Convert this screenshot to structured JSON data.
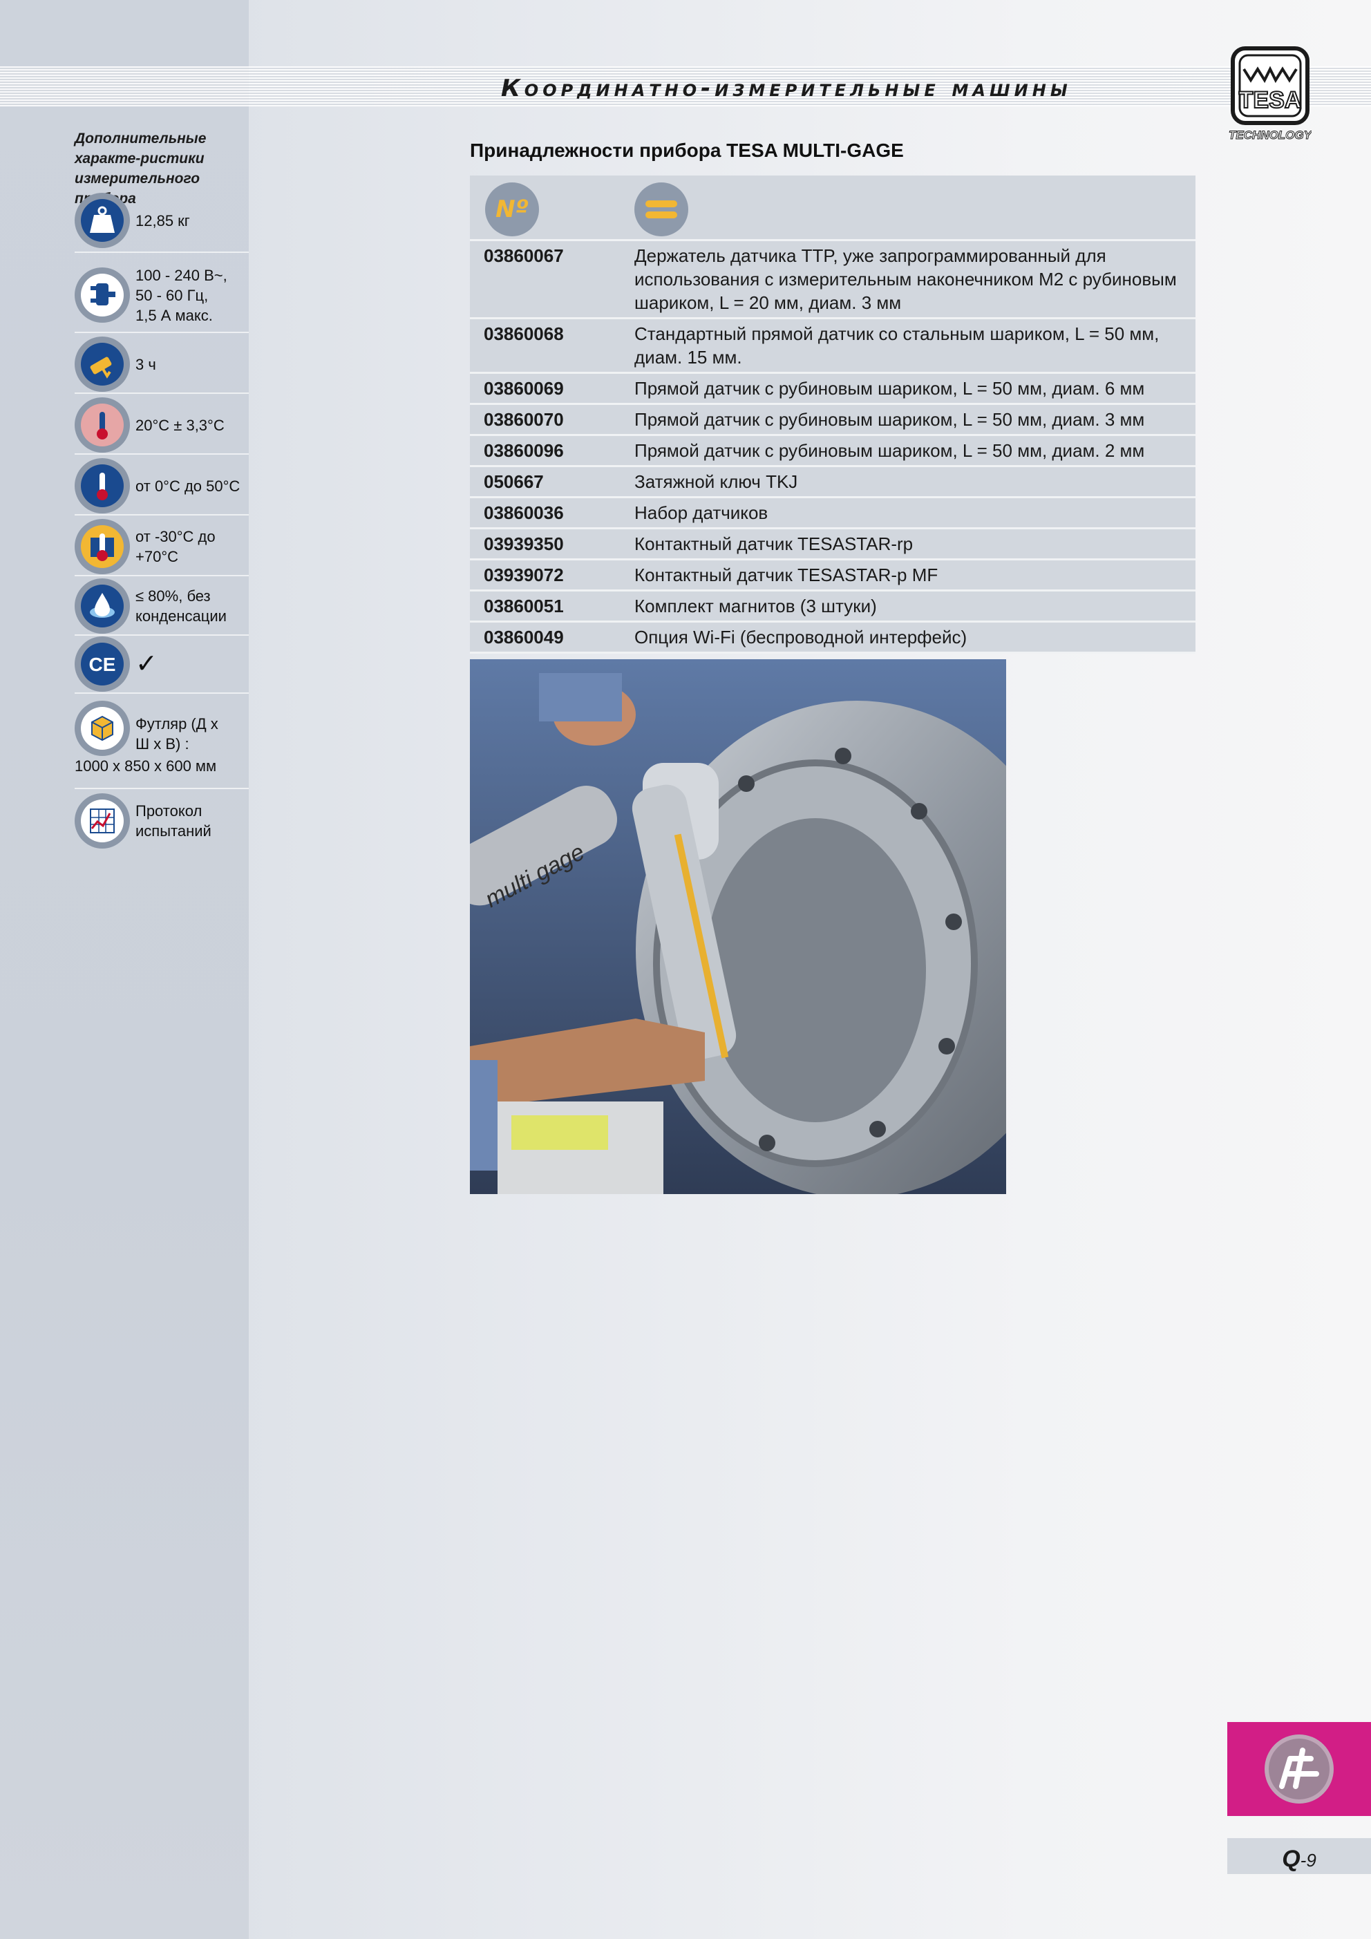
{
  "header": {
    "title": "Координатно-измерительные машины"
  },
  "logo": {
    "brand": "TESA",
    "tagline": "TECHNOLOGY"
  },
  "sidebar": {
    "caption": "Дополнительные характе-ристики измерительного прибора",
    "specs": [
      {
        "icon": "weight-icon",
        "text": "12,85 кг"
      },
      {
        "icon": "power-plug-icon",
        "text": "100 - 240 В~, 50 - 60 Гц, 1,5 А макс."
      },
      {
        "icon": "battery-time-icon",
        "text": "3 ч"
      },
      {
        "icon": "reference-temperature-icon",
        "text": "20°C ± 3,3°C"
      },
      {
        "icon": "operating-temperature-icon",
        "text": "от 0°C до 50°C"
      },
      {
        "icon": "storage-temperature-icon",
        "text": "от -30°C до +70°C"
      },
      {
        "icon": "humidity-icon",
        "text": "≤ 80%, без конденсации"
      },
      {
        "icon": "ce-mark-icon",
        "text": "✓"
      },
      {
        "icon": "case-icon",
        "text": "Футляр (Д x Ш x В) :",
        "text2": "1000 x 850 x 600 мм"
      },
      {
        "icon": "test-report-icon",
        "text": "Протокол испытаний"
      }
    ]
  },
  "main": {
    "section_title": "Принадлежности прибора TESA MULTI-GAGE",
    "table_header": {
      "number_icon": "Nº",
      "description_icon": "equals-icon"
    },
    "rows": [
      {
        "code": "03860067",
        "desc": "Держатель датчика TTP, уже запрограммированный для использования с измерительным наконечником M2 с рубиновым шариком, L = 20 мм, диам. 3 мм"
      },
      {
        "code": "03860068",
        "desc": "Стандартный прямой датчик со стальным шариком, L = 50 мм, диам. 15 мм."
      },
      {
        "code": "03860069",
        "desc": "Прямой датчик с рубиновым шариком, L = 50 мм, диам. 6 мм"
      },
      {
        "code": "03860070",
        "desc": "Прямой датчик с рубиновым шариком, L = 50 мм, диам. 3 мм"
      },
      {
        "code": "03860096",
        "desc": "Прямой датчик с рубиновым шариком, L = 50 мм, диам. 2 мм"
      },
      {
        "code": "050667",
        "desc": "Затяжной ключ TKJ"
      },
      {
        "code": "03860036",
        "desc": "Набор датчиков"
      },
      {
        "code": "03939350",
        "desc": "Контактный датчик TESASTAR-rp"
      },
      {
        "code": "03939072",
        "desc": "Контактный датчик TESASTAR-p MF"
      },
      {
        "code": "03860051",
        "desc": "Комплект магнитов (3 штуки)"
      },
      {
        "code": "03860049",
        "desc": "Опция Wi-Fi (беспроводной интерфейс)"
      }
    ],
    "photo_arm_label": "multi gage"
  },
  "footer": {
    "section_letter": "Q",
    "page_suffix": "-9"
  },
  "colors": {
    "accent_magenta": "#d21e86",
    "icon_blue": "#1a4a8f",
    "row_bg": "#d2d7de"
  }
}
